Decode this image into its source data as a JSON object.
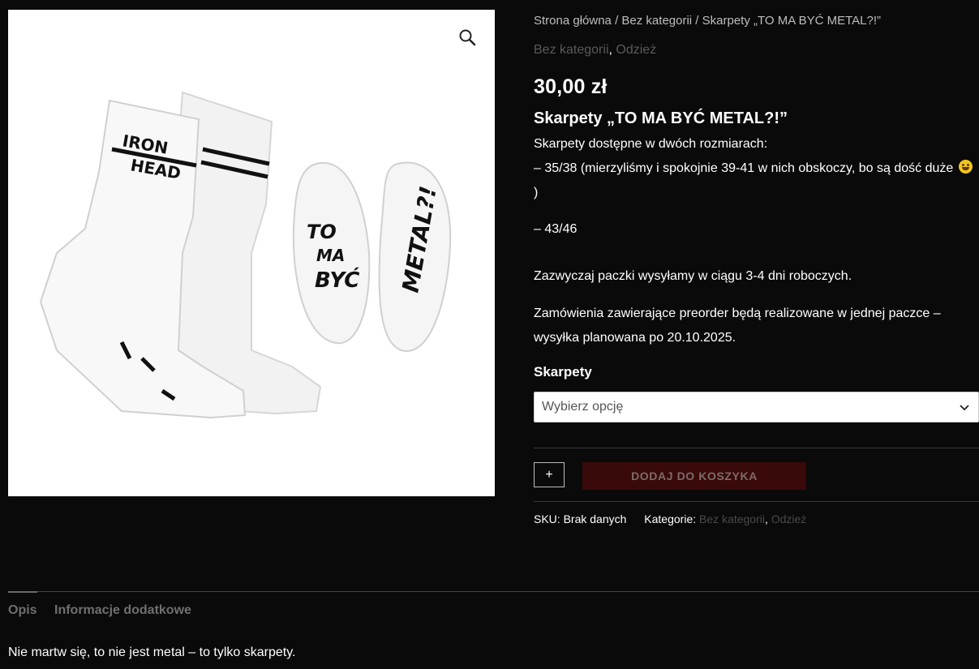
{
  "breadcrumb": {
    "home": "Strona główna",
    "sep1": " / ",
    "category": "Bez kategorii",
    "sep2": " / ",
    "current": "Skarpety „TO MA BYĆ METAL?!”"
  },
  "categories_top": [
    "Bez kategorii",
    "Odzież"
  ],
  "category_separator": ",",
  "price": "30,00 zł",
  "title": "Skarpety „TO MA BYĆ METAL?!”",
  "description": {
    "line1": "Skarpety dostępne w dwóch rozmiarach:",
    "line2": "– 35/38 (mierzyliśmy i spokojnie 39-41 w nich obskoczy, bo są dość duże",
    "line2_end": ")",
    "emoji_icon": "grinning-face-icon",
    "line3": "– 43/46",
    "line4": "Zazwyczaj paczki wysyłamy w ciągu 3-4 dni roboczych.",
    "line5": "Zamówienia zawierające preorder będą realizowane w jednej paczce – wysyłka planowana po 20.10.2025."
  },
  "variation": {
    "label": "Skarpety",
    "selected": "Wybierz opcję"
  },
  "quantity_button": "+",
  "add_to_cart": "DODAJ DO KOSZYKA",
  "meta": {
    "sku_label": "SKU:",
    "sku_value": "Brak danych",
    "categories_label": "Kategorie:",
    "categories": [
      "Bez kategorii",
      "Odzież"
    ]
  },
  "tabs": [
    "Opis",
    "Informacje dodatkowe"
  ],
  "tab_content": "Nie martw się, to nie jest metal – to tylko skarpety.",
  "image_text": {
    "sock1": "IRON\nHEAD",
    "sole1": "TO\nMA\nBYĆ",
    "sole2": "METAL?!"
  },
  "colors": {
    "background": "#0a0a0a",
    "add_button": "#3a0909",
    "muted_link": "#5a5a5a"
  }
}
